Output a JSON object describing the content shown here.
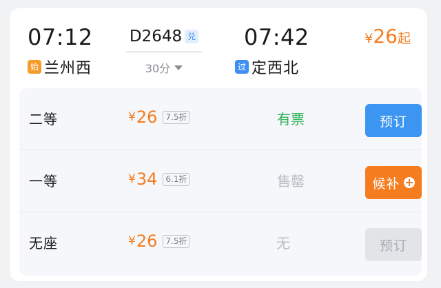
{
  "header": {
    "departure_time": "07:12",
    "departure_badge": "始",
    "departure_station": "兰州西",
    "train_number": "D2648",
    "train_tag": "兑",
    "duration": "30分",
    "arrival_time": "07:42",
    "arrival_badge": "过",
    "arrival_station": "定西北",
    "price_from": {
      "symbol": "¥",
      "value": "26",
      "suffix": "起"
    }
  },
  "seats": [
    {
      "name": "二等",
      "price_symbol": "¥",
      "price": "26",
      "discount": "7.5折",
      "availability": "有票",
      "action": "预订"
    },
    {
      "name": "一等",
      "price_symbol": "¥",
      "price": "34",
      "discount": "6.1折",
      "availability": "售罄",
      "action": "候补"
    },
    {
      "name": "无座",
      "price_symbol": "¥",
      "price": "26",
      "discount": "7.5折",
      "availability": "无",
      "action": "预订"
    }
  ],
  "colors": {
    "accent_orange": "#f57c1f",
    "accent_blue": "#3d95f2",
    "available_green": "#2fb35a",
    "muted_gray": "#b9bcc1"
  }
}
